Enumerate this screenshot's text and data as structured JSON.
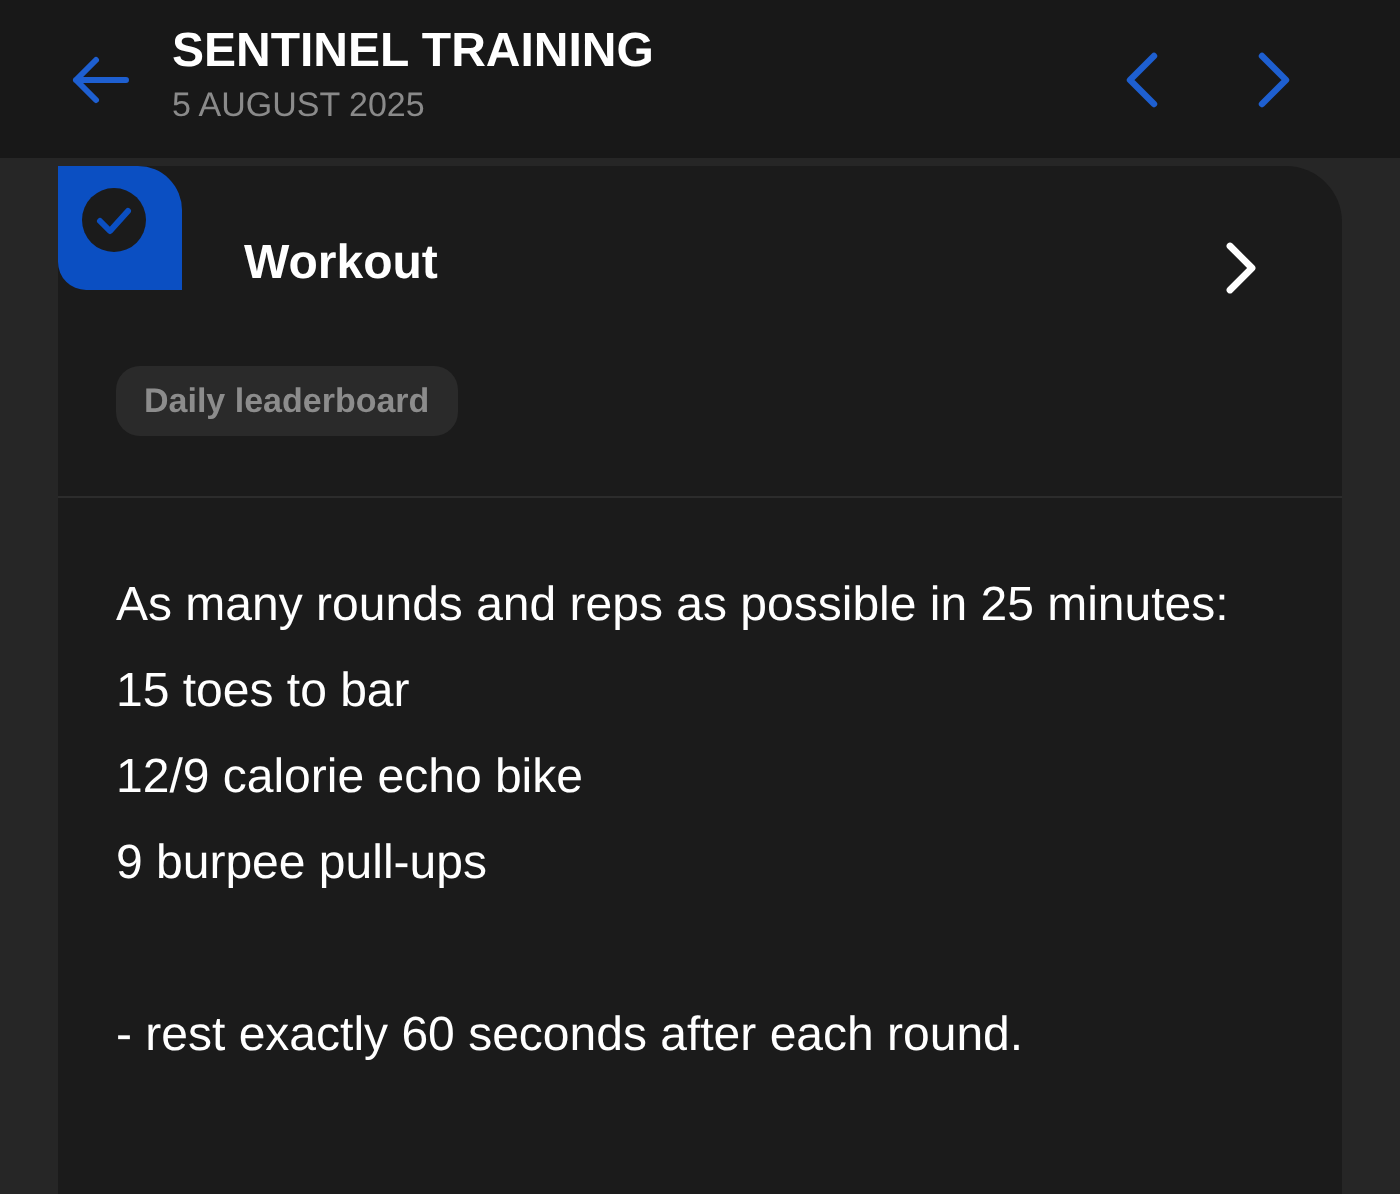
{
  "header": {
    "title": "SENTINEL TRAINING",
    "date": "5 AUGUST 2025"
  },
  "card": {
    "title": "Workout",
    "completed": true,
    "tag": "Daily leaderboard",
    "description": [
      [
        "As many rounds and reps as possible in 25 minutes:",
        "15 toes to bar",
        "12/9 calorie echo bike",
        "9 burpee pull-ups"
      ],
      [
        "- rest exactly 60 seconds after each round."
      ]
    ]
  }
}
